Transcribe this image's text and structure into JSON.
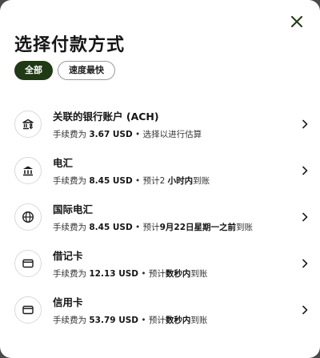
{
  "sheet": {
    "title": "选择付款方式",
    "filters": [
      {
        "label": "全部",
        "active": true
      },
      {
        "label": "速度最快",
        "active": false
      }
    ]
  },
  "methods": [
    {
      "icon": "bank-link-icon",
      "title": "关联的银行账户 (ACH)",
      "fee_prefix": "手续费为 ",
      "fee_amount": "3.67 USD",
      "sep": " • ",
      "eta_prefix": "选择以进行估算",
      "eta_bold": "",
      "eta_suffix": ""
    },
    {
      "icon": "bank-icon",
      "title": "电汇",
      "fee_prefix": "手续费为 ",
      "fee_amount": "8.45 USD",
      "sep": " • ",
      "eta_prefix": "预计2 ",
      "eta_bold": "小时内",
      "eta_suffix": "到账"
    },
    {
      "icon": "globe-icon",
      "title": "国际电汇",
      "fee_prefix": "手续费为 ",
      "fee_amount": "8.45 USD",
      "sep": " • ",
      "eta_prefix": "预计",
      "eta_bold": "9月22日星期一之前",
      "eta_suffix": "到账"
    },
    {
      "icon": "card-icon",
      "title": "借记卡",
      "fee_prefix": "手续费为 ",
      "fee_amount": "12.13 USD",
      "sep": " • ",
      "eta_prefix": "预计",
      "eta_bold": "数秒内",
      "eta_suffix": "到账"
    },
    {
      "icon": "card-icon",
      "title": "信用卡",
      "fee_prefix": "手续费为 ",
      "fee_amount": "53.79 USD",
      "sep": " • ",
      "eta_prefix": "预计",
      "eta_bold": "数秒内",
      "eta_suffix": "到账"
    }
  ]
}
